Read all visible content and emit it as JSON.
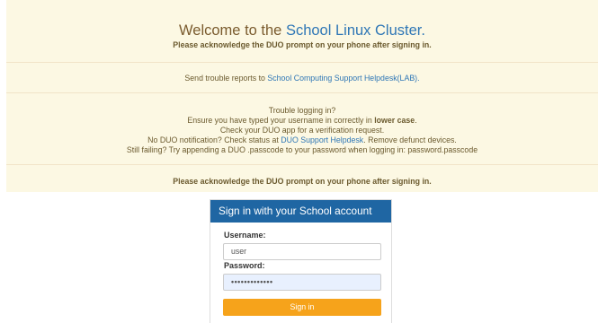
{
  "banner": {
    "welcome_prefix": "Welcome to the",
    "welcome_highlight": "School Linux Cluster.",
    "ack_top": "Please acknowledge the DUO prompt on your phone after signing in.",
    "trouble_prefix": "Send trouble reports to",
    "trouble_link": "School Computing Support Helpdesk(LAB).",
    "help_title": "Trouble logging in?",
    "help_line2_prefix": "Ensure you have typed your username in correctly in",
    "help_line2_bold": "lower case",
    "help_line2_suffix": ".",
    "help_line3": "Check your DUO app for a verification request.",
    "help_line4_prefix": "No DUO notification? Check status at",
    "help_line4_link": "DUO Support Helpdesk",
    "help_line4_suffix": ". Remove defunct devices.",
    "help_line5": "Still failing? Try appending a DUO .passcode to your password when logging in: password.passcode",
    "ack_bottom": "Please acknowledge the DUO prompt on your phone after signing in."
  },
  "login": {
    "title": "Sign in with your School account",
    "username_label": "Username:",
    "username_value": "user",
    "password_label": "Password:",
    "password_value": "•••••••••••••",
    "submit_label": "Sign in"
  },
  "colors": {
    "banner_bg": "#fcf8e3",
    "link": "#2f77b6",
    "card_header": "#1f66a3",
    "button": "#f6a31b"
  }
}
